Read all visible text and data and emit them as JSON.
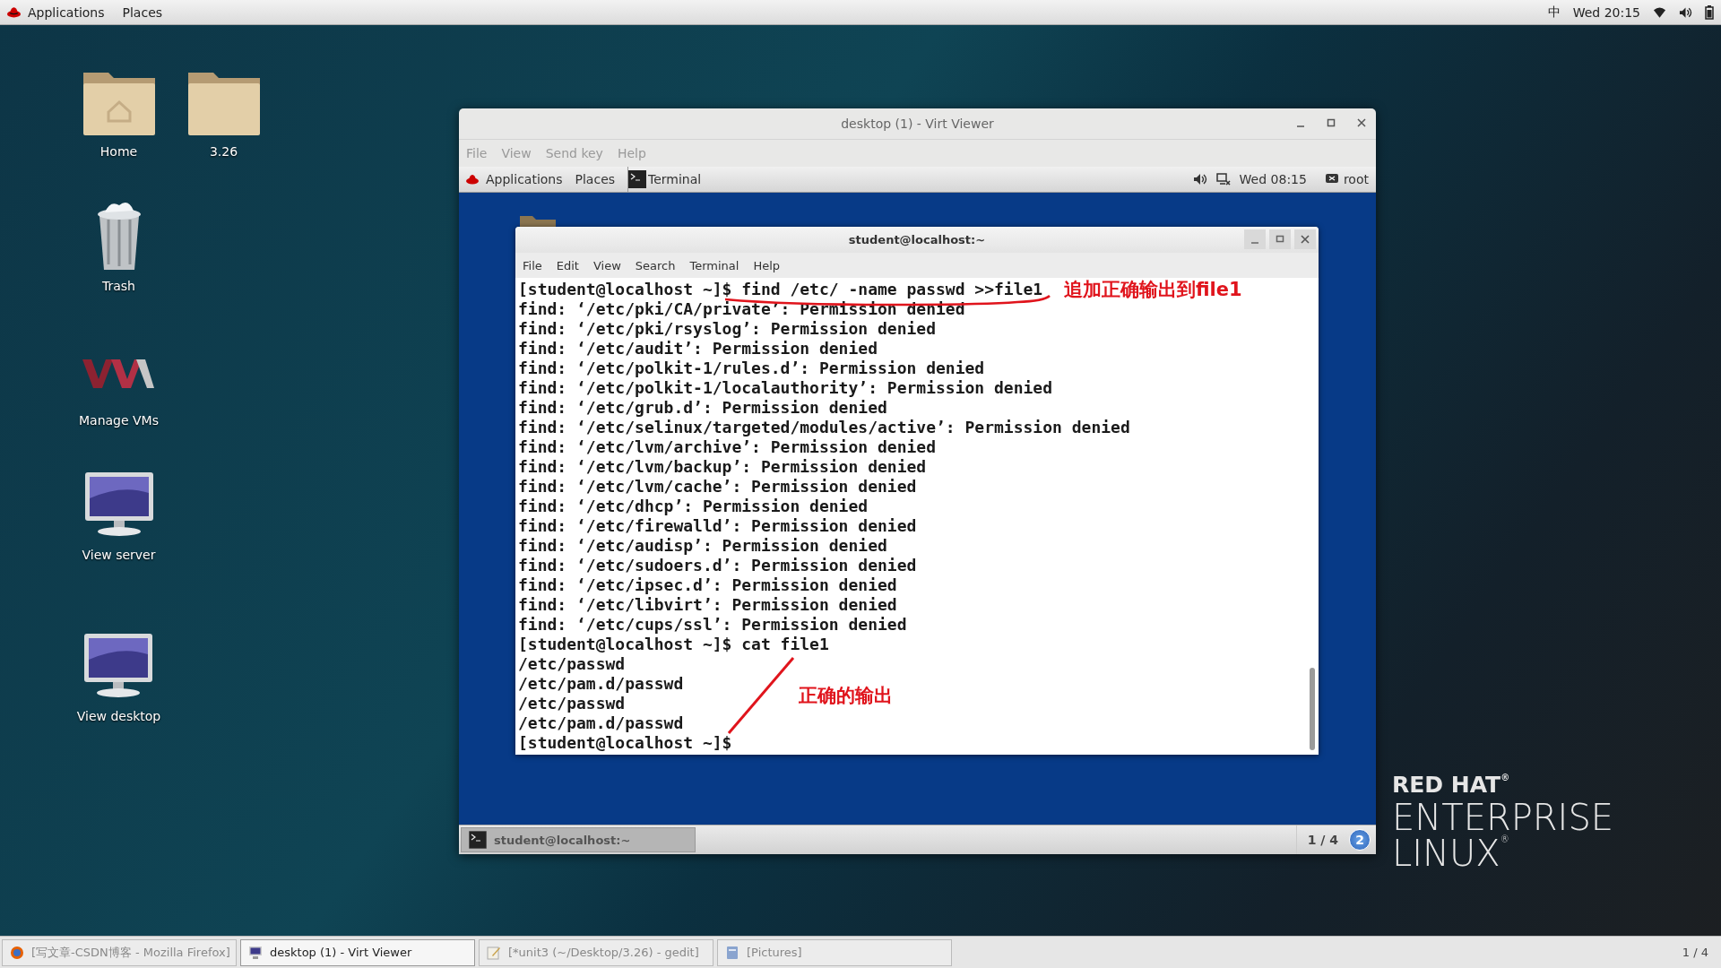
{
  "top_bar": {
    "menus": [
      "Applications",
      "Places"
    ],
    "input_method": "中",
    "clock": "Wed 20:15"
  },
  "desktop_icons": [
    {
      "label": "Home",
      "kind": "home-folder"
    },
    {
      "label": "3.26",
      "kind": "folder"
    },
    {
      "label": "Trash",
      "kind": "trash"
    },
    {
      "label": "Manage VMs",
      "kind": "vm-logo"
    },
    {
      "label": "View server",
      "kind": "monitor"
    },
    {
      "label": "View desktop",
      "kind": "monitor"
    }
  ],
  "viewer_window": {
    "title": "desktop (1) - Virt Viewer",
    "menu": [
      "File",
      "View",
      "Send key",
      "Help"
    ],
    "guest_top_bar": {
      "menus": [
        "Applications",
        "Places"
      ],
      "active_app": "Terminal",
      "clock": "Wed 08:15",
      "user": "root"
    },
    "terminal": {
      "title": "student@localhost:~",
      "menu": [
        "File",
        "Edit",
        "View",
        "Search",
        "Terminal",
        "Help"
      ],
      "lines": [
        "[student@localhost ~]$ find /etc/ -name passwd >>file1",
        "find: ‘/etc/pki/CA/private’: Permission denied",
        "find: ‘/etc/pki/rsyslog’: Permission denied",
        "find: ‘/etc/audit’: Permission denied",
        "find: ‘/etc/polkit-1/rules.d’: Permission denied",
        "find: ‘/etc/polkit-1/localauthority’: Permission denied",
        "find: ‘/etc/grub.d’: Permission denied",
        "find: ‘/etc/selinux/targeted/modules/active’: Permission denied",
        "find: ‘/etc/lvm/archive’: Permission denied",
        "find: ‘/etc/lvm/backup’: Permission denied",
        "find: ‘/etc/lvm/cache’: Permission denied",
        "find: ‘/etc/dhcp’: Permission denied",
        "find: ‘/etc/firewalld’: Permission denied",
        "find: ‘/etc/audisp’: Permission denied",
        "find: ‘/etc/sudoers.d’: Permission denied",
        "find: ‘/etc/ipsec.d’: Permission denied",
        "find: ‘/etc/libvirt’: Permission denied",
        "find: ‘/etc/cups/ssl’: Permission denied",
        "[student@localhost ~]$ cat file1",
        "/etc/passwd",
        "/etc/pam.d/passwd",
        "/etc/passwd",
        "/etc/pam.d/passwd",
        "[student@localhost ~]$"
      ]
    },
    "annotations": [
      {
        "text": "追加正确输出到file1",
        "kind": "underline"
      },
      {
        "text": "正确的输出",
        "kind": "slash"
      }
    ],
    "guest_taskbar": {
      "windows": [
        {
          "label": "student@localhost:~",
          "selected": true
        }
      ],
      "workspace": "1 / 4",
      "badge": "2"
    }
  },
  "logo": {
    "line_1": "RED HAT$^{®}$",
    "line_2": "ENTERPRISE",
    "line_3": "LINUX$^{®}$"
  },
  "taskbar": {
    "windows": [
      {
        "label": "[写文章-CSDN博客 - Mozilla Firefox]",
        "kind": "browser",
        "selected": false
      },
      {
        "label": "desktop (1) - Virt Viewer",
        "kind": "monitor",
        "selected": true
      },
      {
        "label": "[*unit3 (~/Desktop/3.26) - gedit]",
        "kind": "editor",
        "selected": false
      },
      {
        "label": "[Pictures]",
        "kind": "files",
        "selected": false
      }
    ],
    "workspace": "1 / 4"
  }
}
